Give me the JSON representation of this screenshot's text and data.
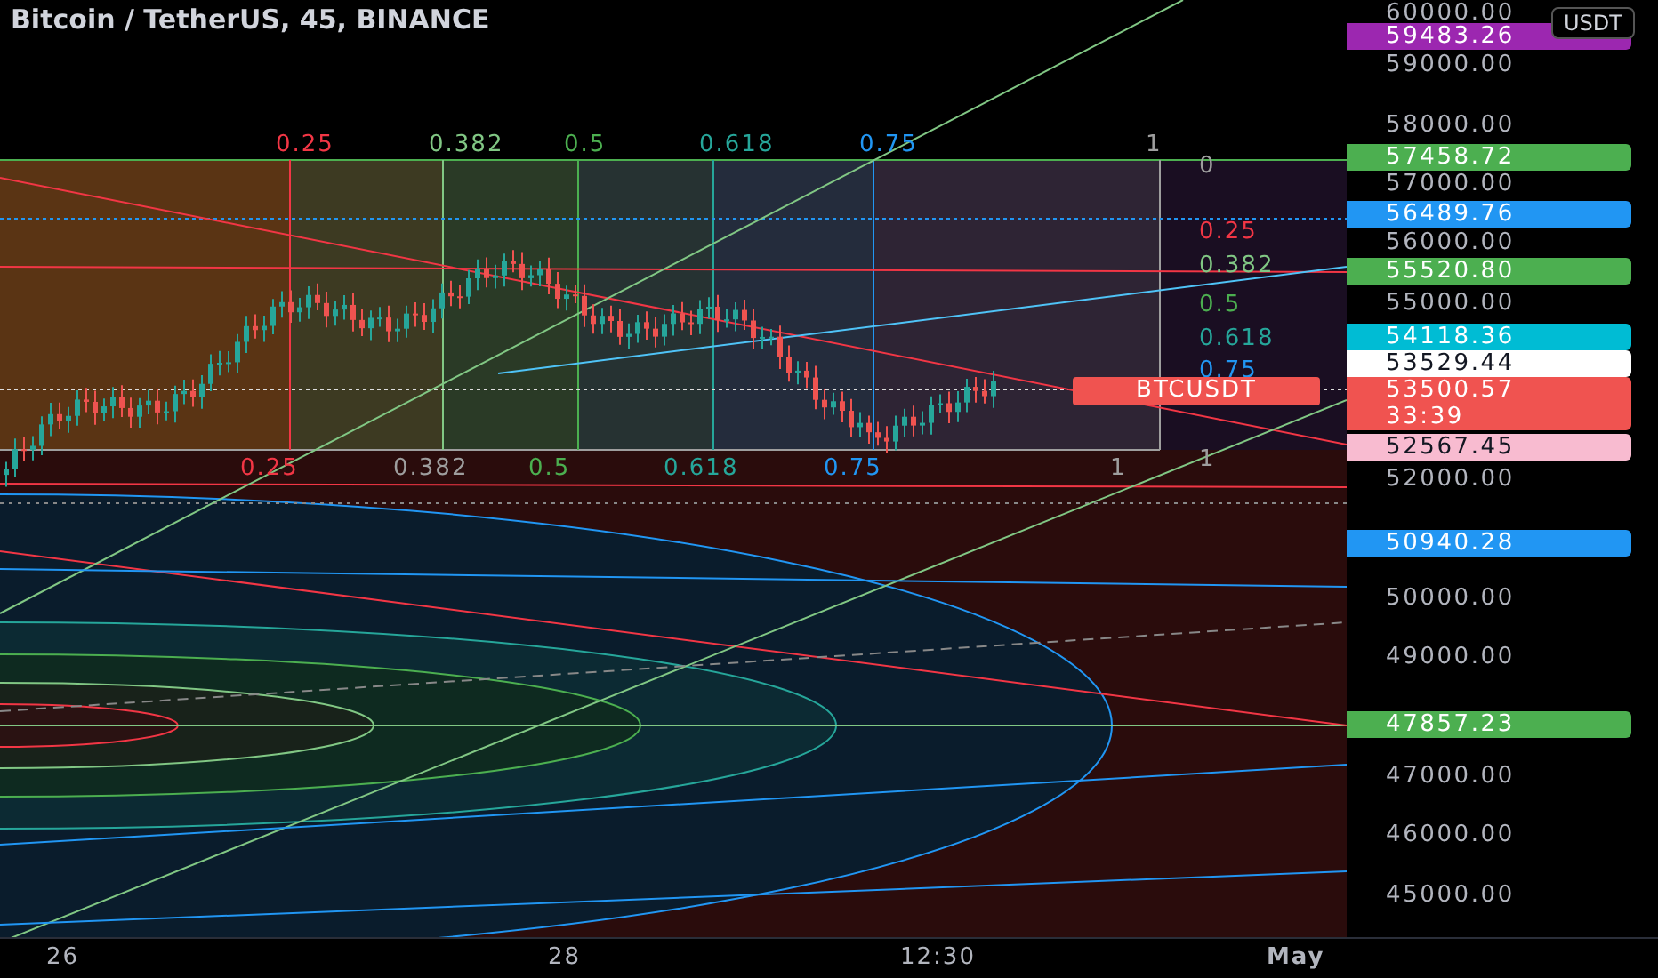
{
  "chart_header": {
    "title": "Bitcoin / TetherUS, 45, BINANCE"
  },
  "currency_button": {
    "label": "USDT"
  },
  "fib_top_labels": [
    {
      "text": "0.25",
      "color": "#f23645"
    },
    {
      "text": "0.382",
      "color": "#81c784"
    },
    {
      "text": "0.5",
      "color": "#4caf50"
    },
    {
      "text": "0.618",
      "color": "#26a69a"
    },
    {
      "text": "0.75",
      "color": "#2196f3"
    },
    {
      "text": "1",
      "color": "#9e9e9e"
    }
  ],
  "fib_right_labels": [
    {
      "text": "0",
      "color": "#9e9e9e"
    },
    {
      "text": "0.25",
      "color": "#f23645"
    },
    {
      "text": "0.382",
      "color": "#81c784"
    },
    {
      "text": "0.5",
      "color": "#4caf50"
    },
    {
      "text": "0.618",
      "color": "#26a69a"
    },
    {
      "text": "0.75",
      "color": "#2196f3"
    },
    {
      "text": "1",
      "color": "#9e9e9e"
    }
  ],
  "fib_bottom_labels": [
    {
      "text": "0.25",
      "color": "#f23645"
    },
    {
      "text": "0.382",
      "color": "#9e9e9e"
    },
    {
      "text": "0.5",
      "color": "#4caf50"
    },
    {
      "text": "0.618",
      "color": "#26a69a"
    },
    {
      "text": "0.75",
      "color": "#2196f3"
    },
    {
      "text": "1",
      "color": "#9e9e9e"
    }
  ],
  "price_ticks": [
    "60000.00",
    "59000.00",
    "58000.00",
    "57000.00",
    "56000.00",
    "55000.00",
    "52000.00",
    "50000.00",
    "49000.00",
    "47000.00",
    "46000.00",
    "45000.00"
  ],
  "price_badges": [
    {
      "text": "59483.26",
      "color": "#9c27b0"
    },
    {
      "text": "57458.72",
      "color": "#4caf50"
    },
    {
      "text": "56489.76",
      "color": "#2196f3"
    },
    {
      "text": "55520.80",
      "color": "#4caf50"
    },
    {
      "text": "54118.36",
      "color": "#00bcd4"
    },
    {
      "text": "53529.44",
      "color": "#ffffff"
    },
    {
      "text": "53500.57",
      "color": "#f05350",
      "countdown": "33:39",
      "symbol": "BTCUSDT"
    },
    {
      "text": "52567.45",
      "color": "#f8bbd0"
    },
    {
      "text": "50940.28",
      "color": "#2196f3"
    },
    {
      "text": "47857.23",
      "color": "#4caf50"
    }
  ],
  "time_labels": [
    "26",
    "28",
    "12:30",
    "May"
  ]
}
